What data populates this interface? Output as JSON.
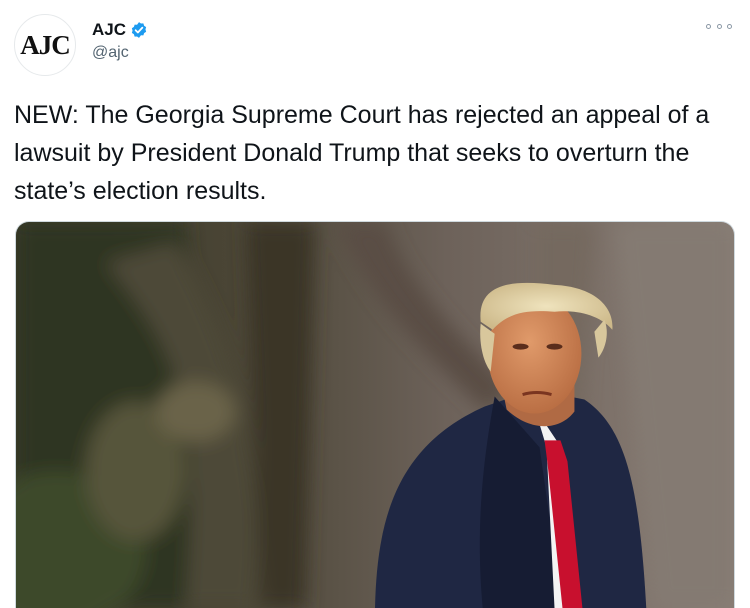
{
  "account": {
    "avatar_text": "AJC",
    "display_name": "AJC",
    "handle": "@ajc",
    "verified": true
  },
  "tweet": {
    "text": "NEW: The Georgia Supreme Court has rejected an appeal of a lawsuit by President Donald Trump that seeks to overturn the state’s election results."
  },
  "icons": {
    "verified": "verified-badge-icon",
    "more": "more-options-icon"
  },
  "colors": {
    "verified_blue": "#1d9bf0",
    "coat_navy": "#1f2743",
    "tie_red": "#c8102e"
  }
}
